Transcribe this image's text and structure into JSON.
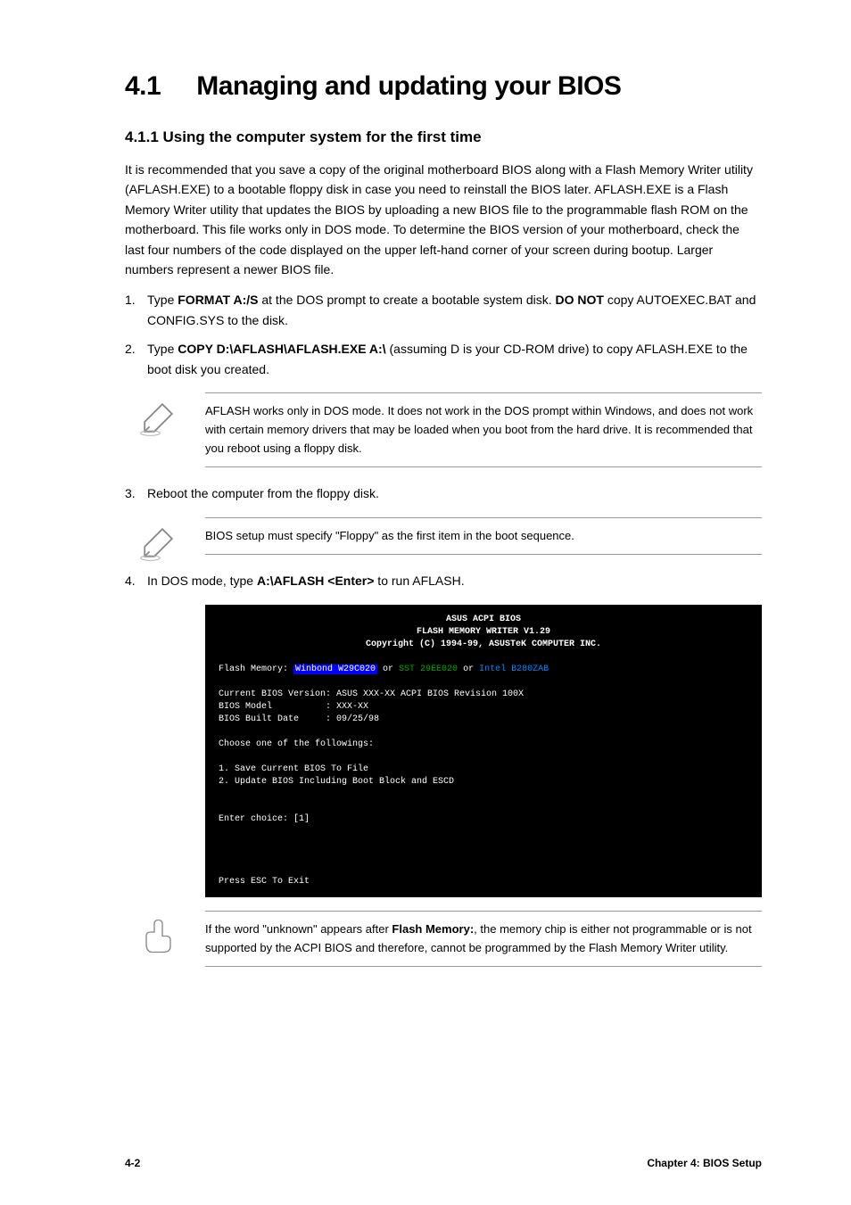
{
  "heading": {
    "number": "4.1",
    "title": "Managing and updating your BIOS"
  },
  "section_4_1_1": {
    "title": "4.1.1 Using the computer system for the first time",
    "para1": "It is recommended that you save a copy of the original motherboard BIOS along with a Flash Memory Writer utility (AFLASH.EXE) to a bootable floppy disk in case you need to reinstall the BIOS later. AFLASH.EXE is a Flash Memory Writer utility that updates the BIOS by uploading a new BIOS file to the programmable flash ROM on the motherboard. This file works only in DOS mode. To determine the BIOS version of your motherboard, check the last four numbers of the code displayed on the upper left-hand corner of your screen during bootup. Larger numbers represent a newer BIOS file.",
    "step1_num": "1.",
    "step1_text_a": "Type ",
    "step1_text_b": "FORMAT A:/S",
    "step1_text_c": " at the DOS prompt to create a bootable system disk. ",
    "step1_text_d": "DO NOT",
    "step1_text_e": " copy AUTOEXEC.BAT and CONFIG.SYS to the disk.",
    "step2_num": "2.",
    "step2_text_a": "Type ",
    "step2_text_b": "COPY D:\\AFLASH\\AFLASH.EXE A:\\",
    "step2_text_c": " (assuming D is your CD-ROM drive) to copy AFLASH.EXE to the boot disk you created."
  },
  "note1": {
    "text": "AFLASH works only in DOS mode. It does not work in the DOS prompt within Windows, and does not work with certain memory drivers that may be loaded when you boot from the hard drive. It is recommended that you reboot using a floppy disk."
  },
  "section_4_1_1b": {
    "step3_num": "3.",
    "step3_text": "Reboot the computer from the floppy disk."
  },
  "note2": {
    "text": "BIOS setup must specify \"Floppy\" as the first item in the boot sequence."
  },
  "section_4_1_1c": {
    "step4_num": "4.",
    "step4_text_a": "In DOS mode, type ",
    "step4_text_b": "A:\\AFLASH <Enter>",
    "step4_text_c": " to run AFLASH."
  },
  "terminal": {
    "header1": "ASUS ACPI BIOS",
    "header2": "FLASH MEMORY WRITER V1.29",
    "header3": "Copyright (C) 1994-99, ASUSTeK COMPUTER INC.",
    "flash_label": "Flash Memory: ",
    "flash_chip1": "Winbond W29C020",
    "flash_or1": " or ",
    "flash_chip2": "SST 29EE020",
    "flash_or2": " or ",
    "flash_chip3": "Intel B280ZAB",
    "line_version": "Current BIOS Version: ASUS XXX-XX ACPI BIOS Revision 100X",
    "line_model": "BIOS Model          : XXX-XX",
    "line_date": "BIOS Built Date     : 09/25/98",
    "choose": "Choose one of the followings:",
    "opt1": "1. Save Current BIOS To File",
    "opt2": "2. Update BIOS Including Boot Block and ESCD",
    "enter": "Enter choice: [1]",
    "exit": "Press ESC To Exit"
  },
  "note3": {
    "text_a": "If the word \"unknown\" appears after ",
    "text_b": "Flash Memory:",
    "text_c": ", the memory chip is either not programmable or is not supported by the ACPI BIOS and therefore, cannot be programmed by the Flash Memory Writer utility."
  },
  "footer": {
    "page": "4-2",
    "chapter": "Chapter 4: BIOS Setup"
  }
}
